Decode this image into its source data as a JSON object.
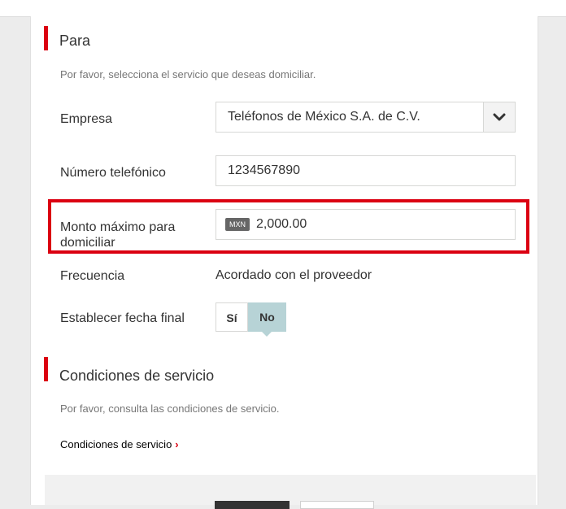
{
  "para": {
    "title": "Para",
    "description": "Por favor, selecciona el servicio que deseas domiciliar."
  },
  "form": {
    "empresa_label": "Empresa",
    "empresa_value": "Teléfonos de México S.A. de C.V.",
    "numero_label": "Número telefónico",
    "numero_value": "1234567890",
    "monto_label_line1": "Monto máximo para",
    "monto_label_line2": "domiciliar",
    "monto_currency": "MXN",
    "monto_value": "2,000.00",
    "frecuencia_label": "Frecuencia",
    "frecuencia_value": "Acordado con el proveedor",
    "fecha_final_label": "Establecer fecha final",
    "toggle_si": "Sí",
    "toggle_no": "No",
    "toggle_selected": "No"
  },
  "condiciones": {
    "title": "Condiciones de servicio",
    "description": "Por favor, consulta las condiciones de servicio.",
    "link": "Condiciones de servicio"
  },
  "colors": {
    "accent": "#db0011",
    "toggle_selected": "#b7d3d6"
  },
  "icons": {
    "select": "chevron-down-icon",
    "link": "chevron-right-icon"
  }
}
